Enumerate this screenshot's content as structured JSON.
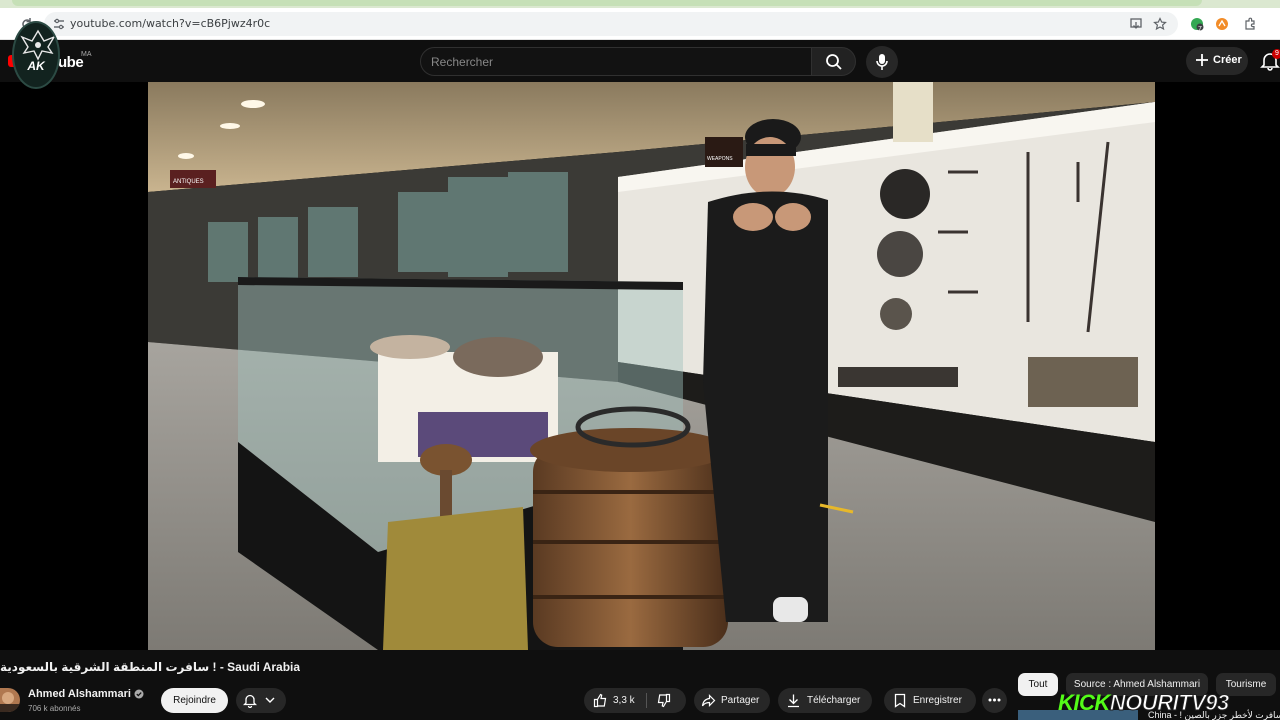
{
  "browser": {
    "url": "youtube.com/watch?v=cB6Pjwz4r0c",
    "extension_badge": "7"
  },
  "header": {
    "logo_text": "ube",
    "country_code": "MA",
    "channel_logo_text": "AK",
    "search_placeholder": "Rechercher",
    "create_label": "Créer",
    "notification_count": "9"
  },
  "video": {
    "title": "سافرت المنطقة الشرقية بالسعودية ! - Saudi Arabia SA",
    "scene": {
      "sign_left": "ANTIQUES",
      "sign_right": "WEAPONS"
    }
  },
  "channel": {
    "name": "Ahmed Alshammari",
    "subscribers": "706 k abonnés",
    "join_label": "Rejoindre"
  },
  "actions": {
    "likes": "3,3 k",
    "share": "Partager",
    "download": "Télécharger",
    "save": "Enregistrer"
  },
  "chips": [
    "Tout",
    "Source : Ahmed Alshammari",
    "Tourisme"
  ],
  "watermark": {
    "part1": "KICK",
    "part2": "NOURITV93"
  },
  "related": {
    "title": "China - ! سافرت لأخطر جزر بالصين"
  },
  "colors": {
    "background": "#0f0f0f",
    "chip_active": "#f1f1f1",
    "chip_inactive": "#272727",
    "kick_green": "#53fc18"
  }
}
